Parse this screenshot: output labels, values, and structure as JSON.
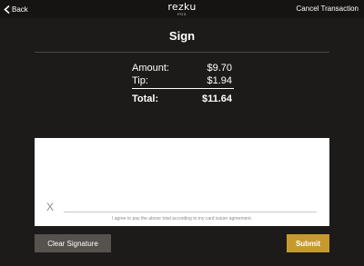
{
  "header": {
    "back_label": "Back",
    "logo_text": "rezku",
    "logo_subtext": "POS",
    "cancel_label": "Cancel Transaction"
  },
  "page": {
    "title": "Sign"
  },
  "totals": {
    "amount_label": "Amount:",
    "amount_value": "$9.70",
    "tip_label": "Tip:",
    "tip_value": "$1.94",
    "total_label": "Total:",
    "total_value": "$11.64"
  },
  "signature": {
    "x_mark": "X",
    "agreement_text": "I agree to pay the above total according to my card issuer agreement."
  },
  "actions": {
    "clear_label": "Clear Signature",
    "submit_label": "Submit"
  },
  "colors": {
    "background": "#1d1b1a",
    "submit_accent": "#c69a2e",
    "clear_button": "#56524e"
  },
  "icons": {
    "back": "chevron-left-icon"
  }
}
